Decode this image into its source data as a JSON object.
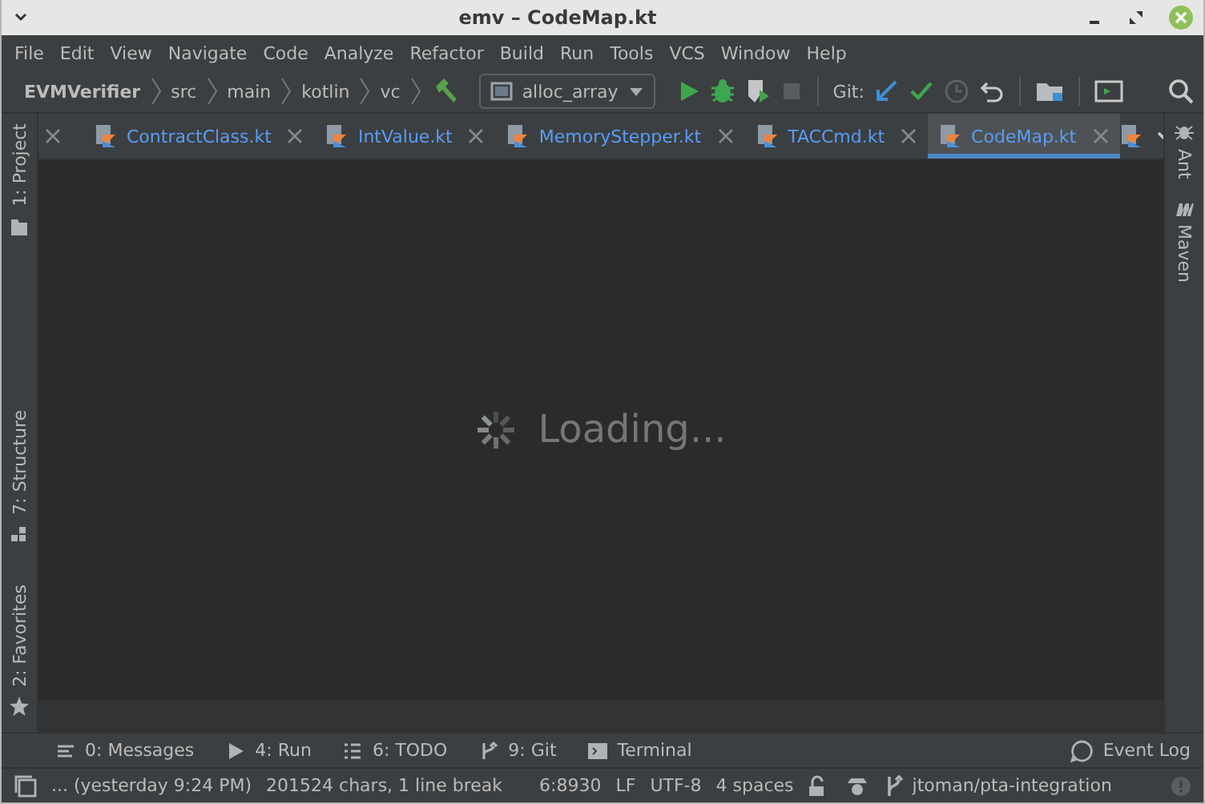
{
  "window": {
    "title": "emv – CodeMap.kt"
  },
  "menu": [
    "File",
    "Edit",
    "View",
    "Navigate",
    "Code",
    "Analyze",
    "Refactor",
    "Build",
    "Run",
    "Tools",
    "VCS",
    "Window",
    "Help"
  ],
  "breadcrumbs": [
    "EVMVerifier",
    "src",
    "main",
    "kotlin",
    "vc"
  ],
  "run_config": "alloc_array",
  "git_label": "Git:",
  "tabs": [
    {
      "label": "ContractClass.kt",
      "selected": false
    },
    {
      "label": "IntValue.kt",
      "selected": false
    },
    {
      "label": "MemoryStepper.kt",
      "selected": false
    },
    {
      "label": "TACCmd.kt",
      "selected": false
    },
    {
      "label": "CodeMap.kt",
      "selected": true
    }
  ],
  "left_tools": [
    {
      "label": "1: Project",
      "kind": "folder"
    },
    {
      "label": "7: Structure",
      "kind": "structure"
    },
    {
      "label": "2: Favorites",
      "kind": "star"
    }
  ],
  "right_tools": [
    {
      "label": "Ant",
      "kind": "ant"
    },
    {
      "label": "Maven",
      "kind": "maven"
    }
  ],
  "editor": {
    "message": "Loading..."
  },
  "bottom_tools": [
    {
      "label": "0: Messages",
      "kind": "messages"
    },
    {
      "label": "4: Run",
      "kind": "run"
    },
    {
      "label": "6: TODO",
      "kind": "todo"
    },
    {
      "label": "9: Git",
      "kind": "git"
    },
    {
      "label": "Terminal",
      "kind": "terminal"
    }
  ],
  "event_log": "Event Log",
  "status_bar": [
    "... (yesterday 9:24 PM)",
    "201524 chars, 1 line break",
    "6:8930",
    "LF",
    "UTF-8",
    "4 spaces"
  ],
  "branch": "jtoman/pta-integration"
}
